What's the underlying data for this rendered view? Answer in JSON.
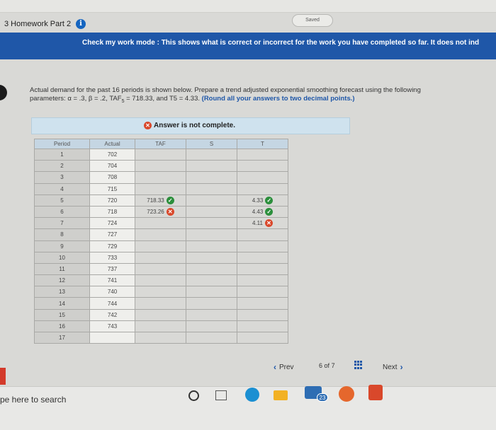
{
  "header": {
    "saved_label": "Saved",
    "assignment_title": "3 Homework Part 2"
  },
  "banner": {
    "text": "Check my work mode : This shows what is correct or incorrect for the work you have completed so far. It does not ind"
  },
  "problem": {
    "line1": "Actual demand for the past 16 periods is shown below. Prepare a trend adjusted exponential smoothing forecast using the following",
    "line2_prefix": "parameters: α = .3, β = .2, TAF",
    "line2_sub": "5",
    "line2_middle": " = 718.33, and T5 = 4.33.",
    "line2_bold": "(Round all your answers to two decimal points.)"
  },
  "status": {
    "text": "Answer is not complete."
  },
  "table": {
    "headers": [
      "Period",
      "Actual",
      "TAF",
      "S",
      "T"
    ],
    "rows": [
      {
        "period": "1",
        "actual": "702",
        "taf": "",
        "taf_status": "",
        "s": "",
        "t": "",
        "t_status": ""
      },
      {
        "period": "2",
        "actual": "704",
        "taf": "",
        "taf_status": "",
        "s": "",
        "t": "",
        "t_status": ""
      },
      {
        "period": "3",
        "actual": "708",
        "taf": "",
        "taf_status": "",
        "s": "",
        "t": "",
        "t_status": ""
      },
      {
        "period": "4",
        "actual": "715",
        "taf": "",
        "taf_status": "",
        "s": "",
        "t": "",
        "t_status": ""
      },
      {
        "period": "5",
        "actual": "720",
        "taf": "718.33",
        "taf_status": "correct",
        "s": "",
        "t": "4.33",
        "t_status": "correct"
      },
      {
        "period": "6",
        "actual": "718",
        "taf": "723.26",
        "taf_status": "incorrect",
        "s": "",
        "t": "4.43",
        "t_status": "correct"
      },
      {
        "period": "7",
        "actual": "724",
        "taf": "",
        "taf_status": "",
        "s": "",
        "t": "4.11",
        "t_status": "incorrect"
      },
      {
        "period": "8",
        "actual": "727",
        "taf": "",
        "taf_status": "",
        "s": "",
        "t": "",
        "t_status": ""
      },
      {
        "period": "9",
        "actual": "729",
        "taf": "",
        "taf_status": "",
        "s": "",
        "t": "",
        "t_status": ""
      },
      {
        "period": "10",
        "actual": "733",
        "taf": "",
        "taf_status": "",
        "s": "",
        "t": "",
        "t_status": ""
      },
      {
        "period": "11",
        "actual": "737",
        "taf": "",
        "taf_status": "",
        "s": "",
        "t": "",
        "t_status": ""
      },
      {
        "period": "12",
        "actual": "741",
        "taf": "",
        "taf_status": "",
        "s": "",
        "t": "",
        "t_status": ""
      },
      {
        "period": "13",
        "actual": "740",
        "taf": "",
        "taf_status": "",
        "s": "",
        "t": "",
        "t_status": ""
      },
      {
        "period": "14",
        "actual": "744",
        "taf": "",
        "taf_status": "",
        "s": "",
        "t": "",
        "t_status": ""
      },
      {
        "period": "15",
        "actual": "742",
        "taf": "",
        "taf_status": "",
        "s": "",
        "t": "",
        "t_status": ""
      },
      {
        "period": "16",
        "actual": "743",
        "taf": "",
        "taf_status": "",
        "s": "",
        "t": "",
        "t_status": ""
      },
      {
        "period": "17",
        "actual": "",
        "taf": "",
        "taf_status": "",
        "s": "",
        "t": "",
        "t_status": ""
      }
    ]
  },
  "nav": {
    "prev_label": "Prev",
    "page_current": "6",
    "page_of": "of",
    "page_total": "7",
    "next_label": "Next"
  },
  "taskbar": {
    "search_placeholder": "pe here to search",
    "mail_badge": "23"
  },
  "icons": {
    "info": "info-icon",
    "incorrect": "x-circle-icon",
    "correct": "check-circle-icon",
    "prev": "chevron-left-icon",
    "next": "chevron-right-icon",
    "pages": "grid-icon"
  },
  "colors": {
    "banner": "#1f57a8",
    "correct": "#2c8f3c",
    "incorrect": "#d9482b",
    "status_bg": "#cfe2ee"
  }
}
